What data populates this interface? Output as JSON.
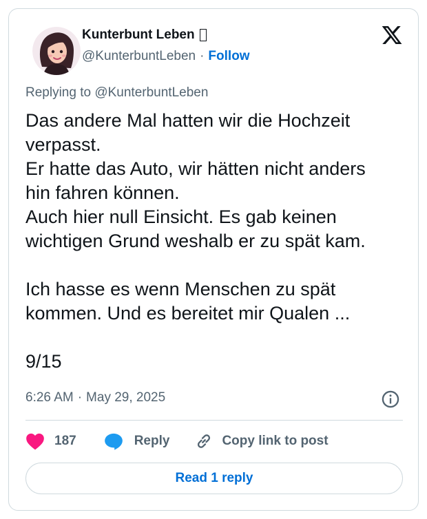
{
  "author": {
    "name": "Kunterbunt Leben",
    "handle": "@KunterbuntLeben",
    "separator": "·",
    "follow_label": "Follow",
    "avatar_icon": "avatar-illustration-icon"
  },
  "reply_context": {
    "text": "Replying to @KunterbuntLeben"
  },
  "tweet": {
    "body": "Das andere Mal hatten wir die Hochzeit\nverpasst.\nEr hatte das Auto, wir hätten nicht anders\nhin fahren können.\nAuch hier null Einsicht. Es gab keinen\nwichtigen Grund weshalb er zu spät kam.\n\nIch hasse es wenn Menschen zu spät\nkommen. Und es bereitet mir Qualen ...\n\n9/15",
    "time": "6:26 AM",
    "separator": "·",
    "date": "May 29, 2025"
  },
  "actions": {
    "like_count": "187",
    "reply_label": "Reply",
    "copy_label": "Copy link to post"
  },
  "read_replies_label": "Read 1 reply",
  "icons": {
    "logo": "x-logo-icon",
    "info": "info-icon",
    "like": "heart-icon",
    "reply": "speech-bubble-icon",
    "copy": "link-icon"
  },
  "colors": {
    "text_primary": "#0f1419",
    "text_secondary": "#536471",
    "link_blue": "#006fd6",
    "like_pink": "#f91880",
    "reply_blue": "#1d9bf0",
    "border": "#cfd9de"
  }
}
